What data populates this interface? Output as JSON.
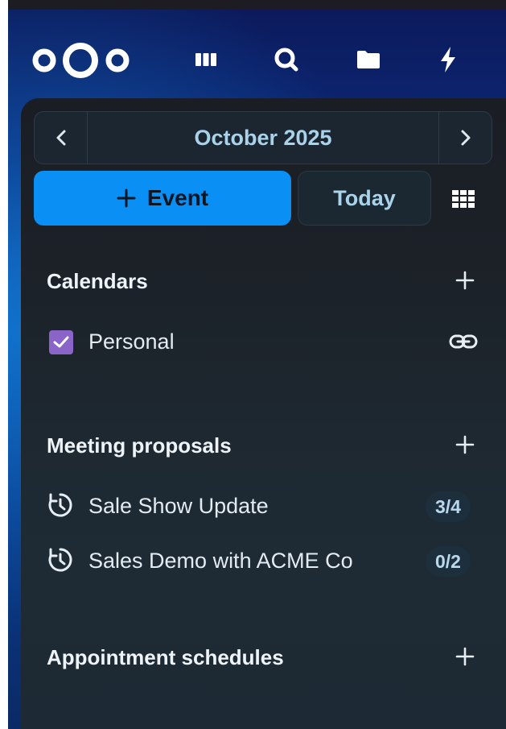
{
  "header": {
    "icons": [
      "nextcloud-logo",
      "dashboard-icon",
      "search-icon",
      "files-icon",
      "activity-icon"
    ]
  },
  "monthnav": {
    "label": "October 2025",
    "prev_icon": "chevron-left-icon",
    "next_icon": "chevron-right-icon"
  },
  "actions": {
    "new_event_label": "Event",
    "today_label": "Today",
    "view_icon": "grid-icon"
  },
  "calendars": {
    "title": "Calendars",
    "items": [
      {
        "label": "Personal",
        "checked": true,
        "color": "#8a64c8",
        "icon": "link-icon"
      }
    ]
  },
  "meeting_proposals": {
    "title": "Meeting proposals",
    "items": [
      {
        "label": "Sale Show Update",
        "badge": "3/4",
        "icon": "clock-icon"
      },
      {
        "label": "Sales Demo with ACME Co",
        "badge": "0/2",
        "icon": "clock-icon"
      }
    ]
  },
  "appointment_schedules": {
    "title": "Appointment schedules"
  },
  "colors": {
    "primary": "#0a8ff4",
    "calendar_personal": "#8a64c8",
    "accent_text": "#a9d3ea"
  }
}
